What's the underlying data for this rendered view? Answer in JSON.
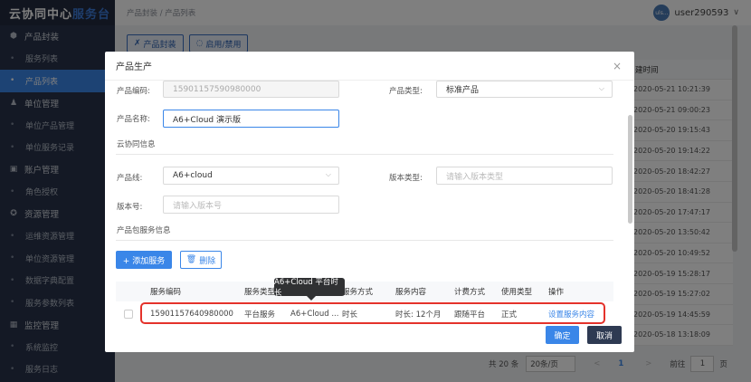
{
  "app": {
    "logo_main": "云协同中心",
    "logo_accent": "服务台"
  },
  "sidebar": {
    "groups": [
      {
        "label": "产品封装",
        "icon": "cube-icon",
        "items": [
          "服务列表",
          "产品列表"
        ]
      },
      {
        "label": "单位管理",
        "icon": "users-icon",
        "items": [
          "单位产品管理",
          "单位服务记录"
        ]
      },
      {
        "label": "账户管理",
        "icon": "account-icon",
        "items": [
          "角色授权"
        ]
      },
      {
        "label": "资源管理",
        "icon": "resource-icon",
        "items": [
          "运维资源管理",
          "单位资源管理",
          "数据字典配置",
          "服务参数列表"
        ]
      },
      {
        "label": "监控管理",
        "icon": "monitor-icon",
        "items": [
          "系统监控",
          "服务日志"
        ]
      }
    ],
    "active_item": "产品列表"
  },
  "header": {
    "breadcrumb": "产品封装 / 产品列表",
    "avatar_text": "uls...",
    "username": "user290593"
  },
  "toolbar": {
    "package_label": "产品封装",
    "toggle_label": "启用/禁用"
  },
  "bg_table": {
    "header": "建时间",
    "times": [
      "2020-05-21 10:21:39",
      "2020-05-21 09:00:23",
      "2020-05-20 19:15:43",
      "2020-05-20 19:14:22",
      "2020-05-20 18:42:27",
      "2020-05-20 18:41:28",
      "2020-05-20 17:47:17",
      "2020-05-20 13:50:42",
      "2020-05-20 10:49:52",
      "2020-05-19 15:28:17",
      "2020-05-19 15:27:02",
      "2020-05-19 14:45:59",
      "2020-05-18 13:18:09"
    ]
  },
  "pager": {
    "total": "共 20 条",
    "page_size": "20条/页",
    "prev": "<",
    "current": "1",
    "next": ">",
    "goto": "前往",
    "goto_value": "1",
    "page_unit": "页"
  },
  "modal": {
    "title": "产品生产",
    "close": "×",
    "product_code_label": "产品编码:",
    "product_code_value": "15901157590980000",
    "product_type_label": "产品类型:",
    "product_type_value": "标准产品",
    "product_name_label": "产品名称:",
    "product_name_value": "A6+Cloud 演示版",
    "section_cloud": "云协同信息",
    "product_line_label": "产品线:",
    "product_line_value": "A6+cloud",
    "version_type_label": "版本类型:",
    "version_type_placeholder": "请输入版本类型",
    "version_no_label": "版本号:",
    "version_no_placeholder": "请输入版本号",
    "section_service": "产品包服务信息",
    "add_service": "+ 添加服务",
    "delete": "删除",
    "table": {
      "headers": [
        "服务编码",
        "服务类型",
        "",
        "服务方式",
        "服务内容",
        "计费方式",
        "使用类型",
        "操作"
      ],
      "row": {
        "code": "15901157640980000",
        "type": "平台服务",
        "name": "A6+Cloud ...",
        "mode": "时长",
        "content": "时长: 12个月",
        "billing": "跟随平台",
        "usage": "正式",
        "action": "设置服务内容"
      }
    },
    "tooltip": "A6+Cloud 平台时长",
    "confirm": "确定",
    "cancel": "取消"
  }
}
